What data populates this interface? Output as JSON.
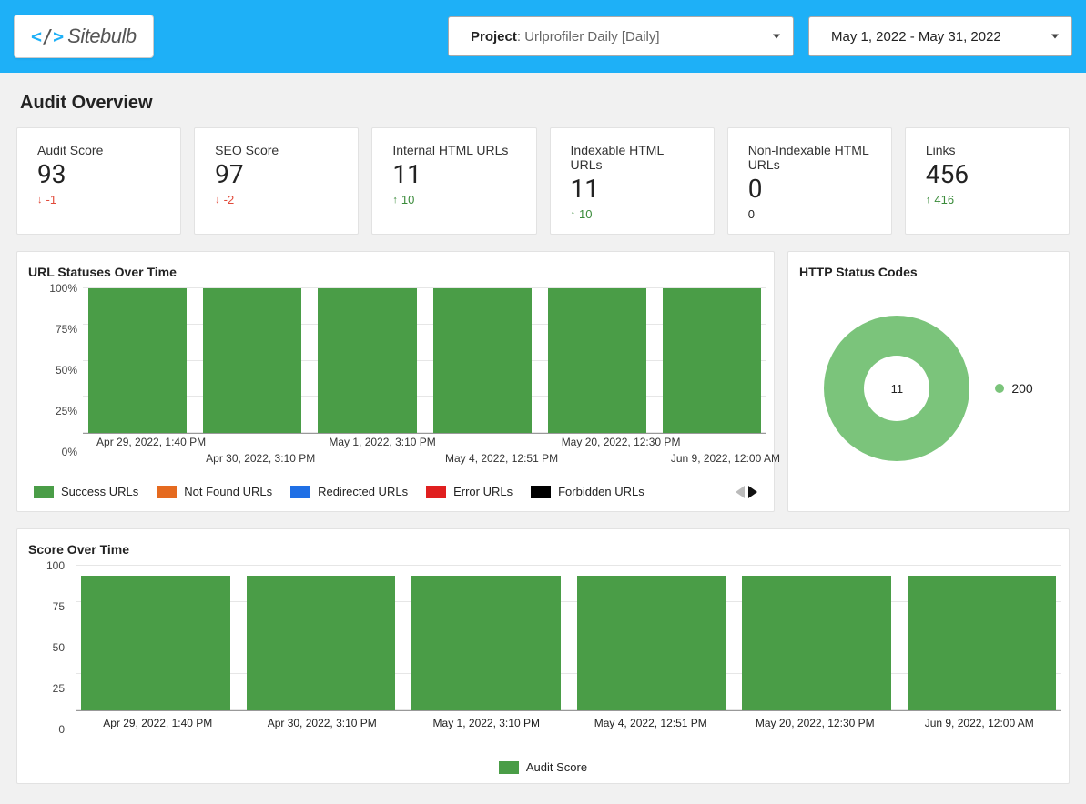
{
  "brand": "Sitebulb",
  "header": {
    "project_label": "Project",
    "project_value": ": Urlprofiler Daily [Daily]",
    "date_range": "May 1, 2022 - May 31, 2022"
  },
  "section_title": "Audit Overview",
  "cards": [
    {
      "title": "Audit Score",
      "value": "93",
      "delta": "-1",
      "dir": "down"
    },
    {
      "title": "SEO Score",
      "value": "97",
      "delta": "-2",
      "dir": "down"
    },
    {
      "title": "Internal HTML URLs",
      "value": "11",
      "delta": "10",
      "dir": "up"
    },
    {
      "title": "Indexable HTML URLs",
      "value": "11",
      "delta": "10",
      "dir": "up"
    },
    {
      "title": "Non-Indexable HTML URLs",
      "value": "0",
      "delta": "0",
      "dir": "none"
    },
    {
      "title": "Links",
      "value": "456",
      "delta": "416",
      "dir": "up"
    }
  ],
  "url_status_chart_title": "URL Statuses Over Time",
  "http_status_title": "HTTP Status Codes",
  "score_chart_title": "Score Over Time",
  "donut_center": "11",
  "donut_legend": "200",
  "legend_items": [
    {
      "label": "Success URLs",
      "color": "#4a9d47"
    },
    {
      "label": "Not Found URLs",
      "color": "#e56a1f"
    },
    {
      "label": "Redirected URLs",
      "color": "#1f6fe5"
    },
    {
      "label": "Error URLs",
      "color": "#e01f1f"
    },
    {
      "label": "Forbidden URLs",
      "color": "#000000"
    }
  ],
  "score_legend": "Audit Score",
  "chart_data": [
    {
      "type": "bar",
      "title": "URL Statuses Over Time",
      "ylabel": "",
      "ylim": [
        0,
        100
      ],
      "y_ticks": [
        "0%",
        "25%",
        "50%",
        "75%",
        "100%"
      ],
      "categories": [
        "Apr 29, 2022, 1:40 PM",
        "Apr 30, 2022, 3:10 PM",
        "May 1, 2022, 3:10 PM",
        "May 4, 2022, 12:51 PM",
        "May 20, 2022, 12:30 PM",
        "Jun 9, 2022, 12:00 AM"
      ],
      "series": [
        {
          "name": "Success URLs",
          "values": [
            100,
            100,
            100,
            100,
            100,
            100
          ]
        },
        {
          "name": "Not Found URLs",
          "values": [
            0,
            0,
            0,
            0,
            0,
            0
          ]
        },
        {
          "name": "Redirected URLs",
          "values": [
            0,
            0,
            0,
            0,
            0,
            0
          ]
        },
        {
          "name": "Error URLs",
          "values": [
            0,
            0,
            0,
            0,
            0,
            0
          ]
        },
        {
          "name": "Forbidden URLs",
          "values": [
            0,
            0,
            0,
            0,
            0,
            0
          ]
        }
      ]
    },
    {
      "type": "bar",
      "title": "Score Over Time",
      "ylabel": "",
      "ylim": [
        0,
        100
      ],
      "y_ticks": [
        "0",
        "25",
        "50",
        "75",
        "100"
      ],
      "categories": [
        "Apr 29, 2022, 1:40 PM",
        "Apr 30, 2022, 3:10 PM",
        "May 1, 2022, 3:10 PM",
        "May 4, 2022, 12:51 PM",
        "May 20, 2022, 12:30 PM",
        "Jun 9, 2022, 12:00 AM"
      ],
      "series": [
        {
          "name": "Audit Score",
          "values": [
            93,
            93,
            93,
            93,
            93,
            93
          ]
        }
      ]
    },
    {
      "type": "pie",
      "title": "HTTP Status Codes",
      "series": [
        {
          "name": "200",
          "value": 11
        }
      ]
    }
  ]
}
